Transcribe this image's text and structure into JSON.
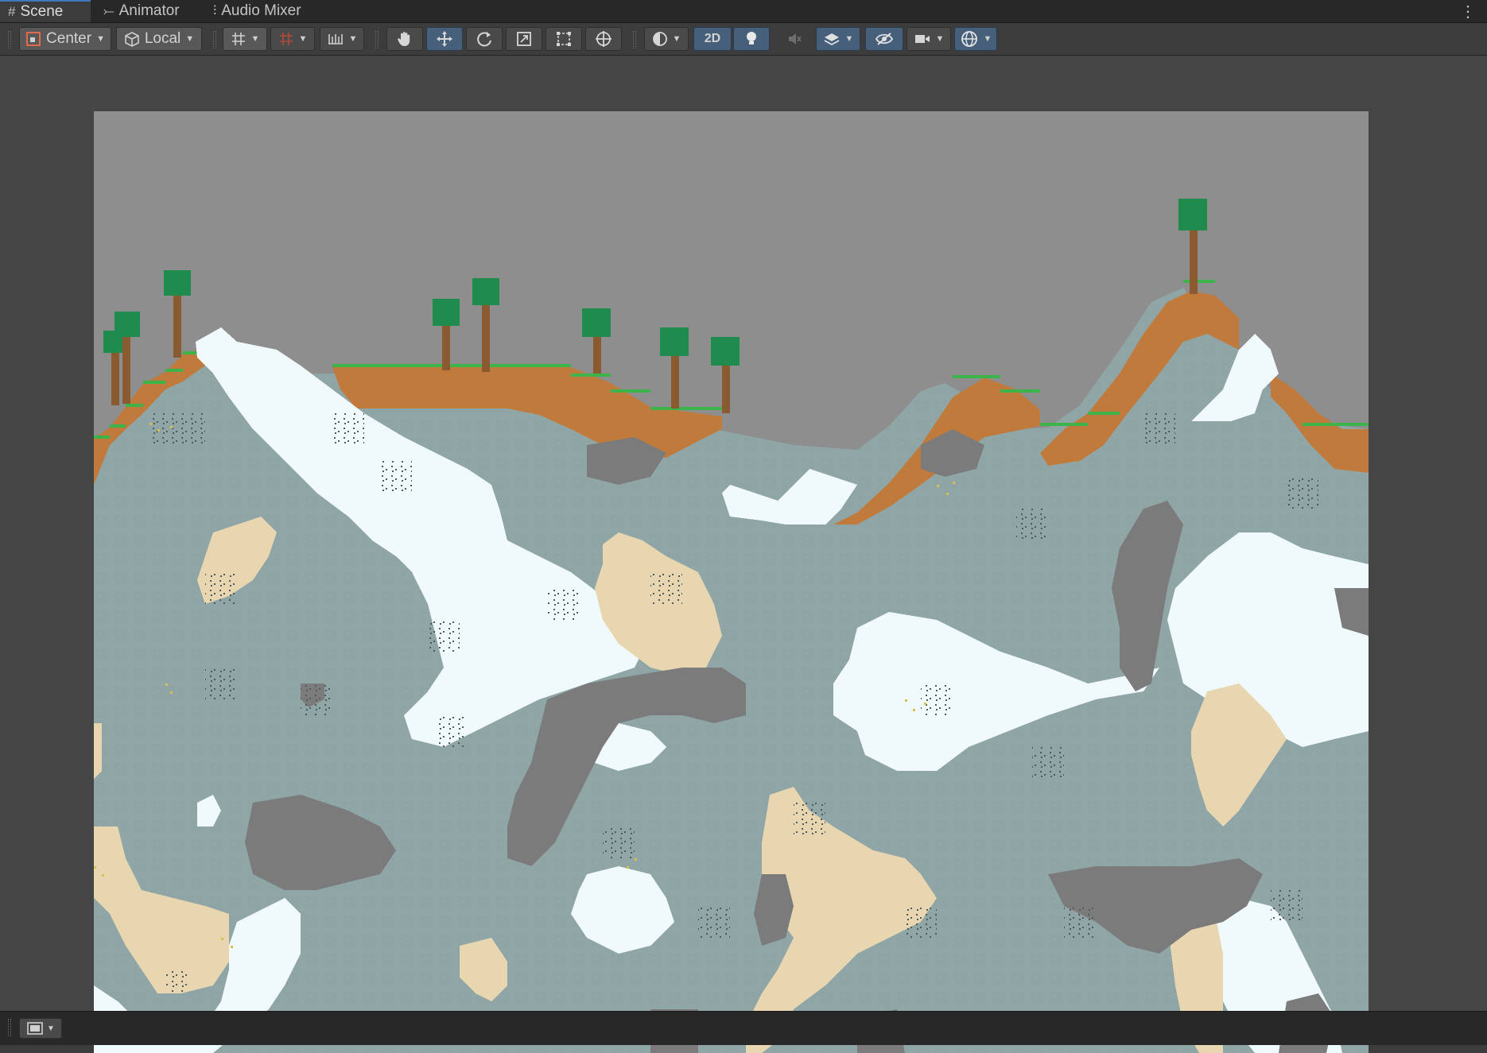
{
  "tabs": [
    {
      "label": "Scene",
      "icon": "grid-icon",
      "active": true
    },
    {
      "label": "Animator",
      "icon": "animator-icon",
      "active": false
    },
    {
      "label": "Audio Mixer",
      "icon": "mixer-sliders-icon",
      "active": false
    }
  ],
  "toolbar": {
    "pivot_label": "Center",
    "space_label": "Local",
    "mode_2d_label": "2D",
    "tools": [
      "hand-tool",
      "move-tool",
      "rotate-tool",
      "scale-tool",
      "rect-tool",
      "transform-tool"
    ],
    "toggles": [
      "draw-mode",
      "2d-toggle",
      "lighting-toggle",
      "audio-toggle",
      "effects-toggle",
      "hidden-toggle",
      "camera-settings",
      "gizmos-toggle"
    ]
  },
  "colors": {
    "sky": "#8e8e8e",
    "stone": "#8fa5a6",
    "snow": "#f0f9fb",
    "sand": "#e8d6b0",
    "gravel": "#7b7b7b",
    "dirt": "#c07a3c",
    "grass": "#3cb44a",
    "trunk": "#8a5a30",
    "leaves": "#1f8c4e",
    "accent": "#3a79bb"
  }
}
